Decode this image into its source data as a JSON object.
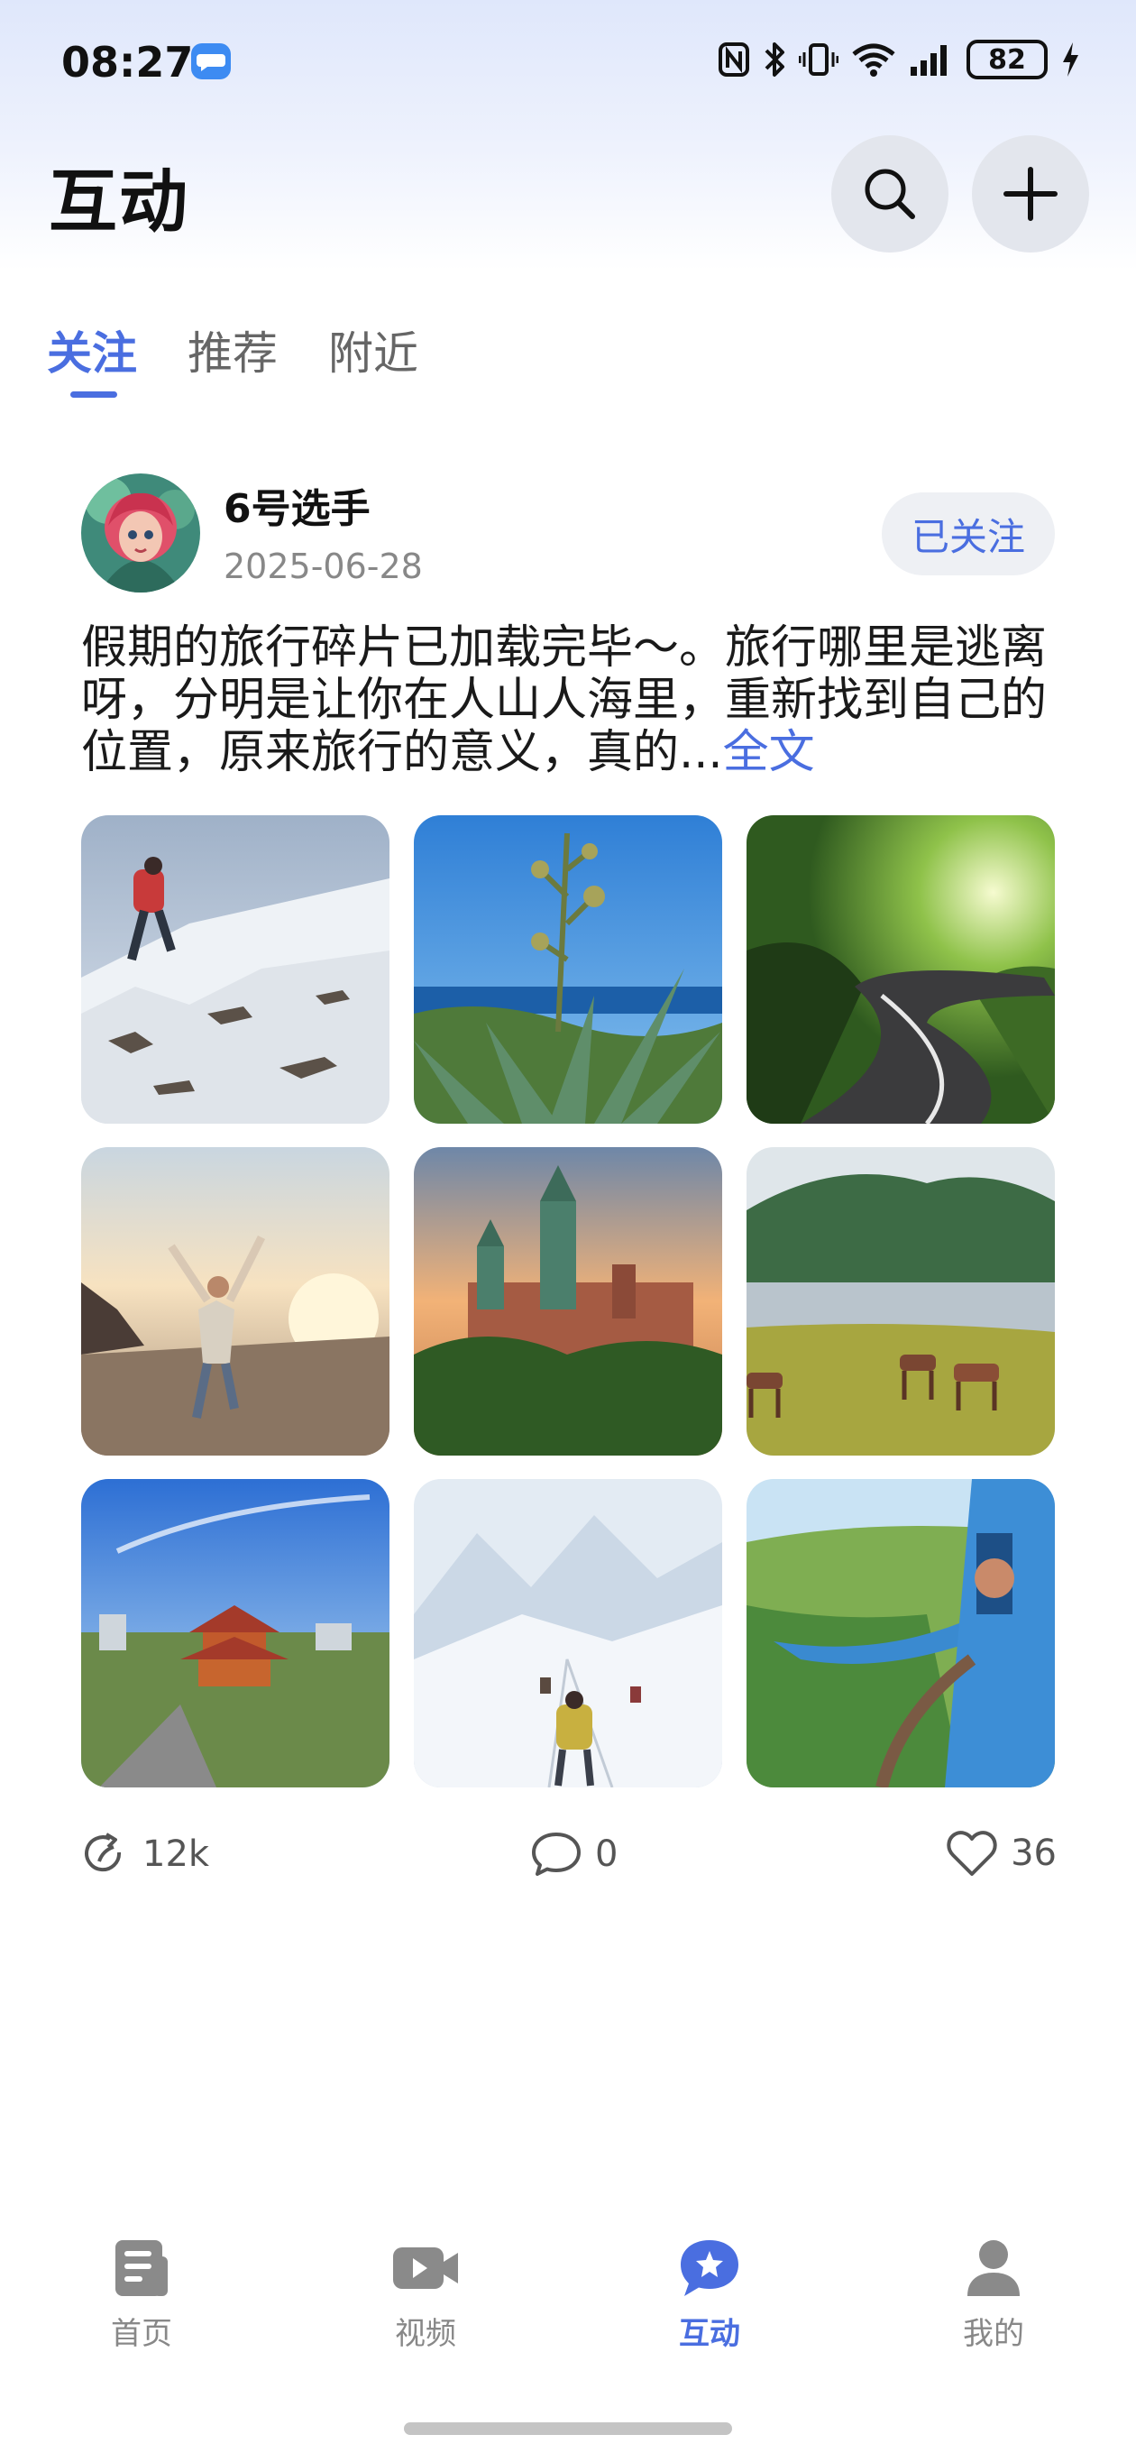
{
  "status_bar": {
    "time": "08:27",
    "battery": "82",
    "icons": [
      "message-icon",
      "nfc-icon",
      "bluetooth-icon",
      "vibrate-icon",
      "wifi-icon",
      "signal-icon",
      "battery-icon",
      "charging-icon"
    ]
  },
  "header": {
    "title": "互动",
    "search_icon": "search-icon",
    "add_icon": "plus-icon"
  },
  "tabs": [
    {
      "label": "关注",
      "active": true
    },
    {
      "label": "推荐",
      "active": false
    },
    {
      "label": "附近",
      "active": false
    }
  ],
  "post": {
    "username": "6号选手",
    "date": "2025-06-28",
    "follow_label": "已关注",
    "text": "假期的旅行碎片已加载完毕～。旅行哪里是逃离呀，分明是让你在人山人海里，重新找到自己的位置，原来旅行的意义，真的...",
    "more_label": "全文",
    "photos": [
      "photo-mountain-hiker",
      "photo-agave-coast",
      "photo-forest-road",
      "photo-beach-traveler",
      "photo-castle-sunset",
      "photo-lake-horses",
      "photo-pavilion-city",
      "photo-snow-climbers",
      "photo-train-countryside"
    ],
    "share_count": "12k",
    "comment_count": "0",
    "like_count": "36"
  },
  "bottom_nav": [
    {
      "label": "首页",
      "icon": "news-icon",
      "active": false
    },
    {
      "label": "视频",
      "icon": "video-icon",
      "active": false
    },
    {
      "label": "互动",
      "icon": "star-chat-icon",
      "active": true
    },
    {
      "label": "我的",
      "icon": "person-icon",
      "active": false
    }
  ],
  "colors": {
    "accent": "#4a6ee0",
    "muted_text": "#888888",
    "button_bg": "#e3e6ed"
  }
}
